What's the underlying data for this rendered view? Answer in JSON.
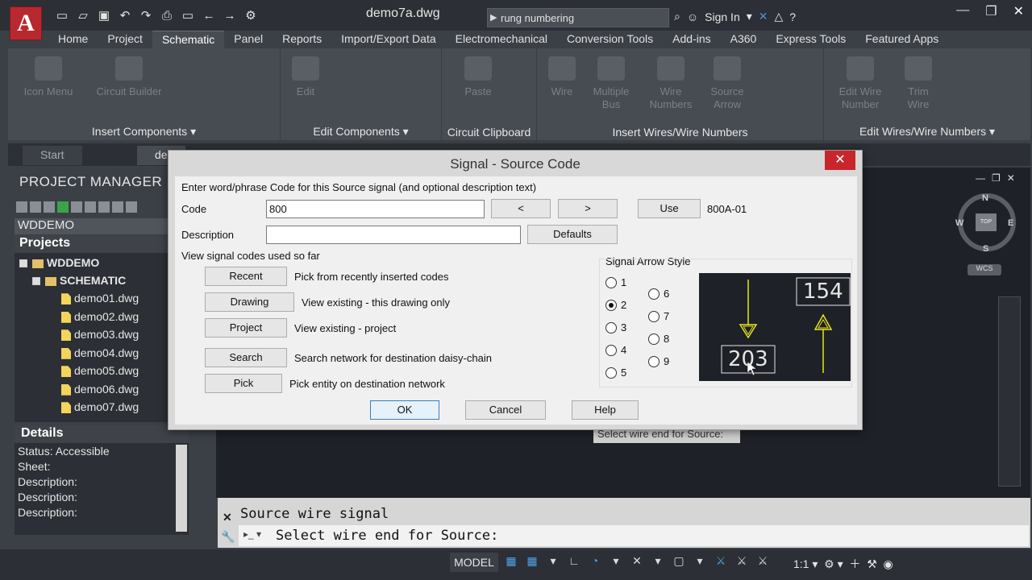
{
  "app": {
    "logo": "A",
    "doc_title": "demo7a.dwg",
    "search_value": "rung numbering",
    "sign_in": "Sign In"
  },
  "ribbon": {
    "tabs": [
      "Home",
      "Project",
      "Schematic",
      "Panel",
      "Reports",
      "Import/Export Data",
      "Electromechanical",
      "Conversion Tools",
      "Add-ins",
      "A360",
      "Express Tools",
      "Featured Apps"
    ],
    "active_tab": "Schematic",
    "groups": [
      {
        "title": "Insert Components",
        "buttons": [
          "Icon Menu",
          "Circuit Builder"
        ]
      },
      {
        "title": "Edit Components",
        "buttons": [
          "Edit"
        ]
      },
      {
        "title": "Circuit Clipboard",
        "buttons": [
          "Paste"
        ]
      },
      {
        "title": "Insert Wires/Wire Numbers",
        "buttons": [
          "Wire",
          "Multiple Bus",
          "Wire Numbers",
          "Source Arrow"
        ]
      },
      {
        "title": "Edit Wires/Wire Numbers",
        "buttons": [
          "Edit Wire Number",
          "Trim Wire"
        ]
      }
    ]
  },
  "doc_tabs": [
    "Start",
    "de"
  ],
  "project_manager": {
    "title": "PROJECT MANAGER",
    "project_selector": "WDDEMO",
    "tree_header": "Projects",
    "root": "WDDEMO",
    "folder": "SCHEMATIC",
    "files": [
      "demo01.dwg",
      "demo02.dwg",
      "demo03.dwg",
      "demo04.dwg",
      "demo05.dwg",
      "demo06.dwg",
      "demo07.dwg"
    ]
  },
  "details": {
    "title": "Details",
    "rows": [
      "Status: Accessible",
      "Sheet:",
      "Description:",
      "Description:",
      "Description:"
    ]
  },
  "drawing": {
    "viewcube": {
      "n": "N",
      "s": "S",
      "e": "E",
      "w": "W",
      "top": "TOP",
      "wcs": "WCS"
    },
    "tooltip": "Select wire end for Source:"
  },
  "command_line": {
    "history": "Source wire signal",
    "prompt": "Select wire end for Source:"
  },
  "status_bar": {
    "model": "MODEL",
    "scale": "1:1"
  },
  "dialog": {
    "title": "Signal - Source Code",
    "close": "✕",
    "instructions": "Enter word/phrase Code for this Source signal (and optional description text)",
    "code_label": "Code",
    "code_value": "800",
    "prev_label": "<",
    "next_label": ">",
    "use_label": "Use",
    "use_value": "800A-01",
    "description_label": "Description",
    "description_value": "",
    "defaults_label": "Defaults",
    "view_label": "View signal codes used so far",
    "view_buttons": [
      {
        "label": "Recent",
        "desc": "Pick from recently inserted codes"
      },
      {
        "label": "Drawing",
        "desc": "View existing - this drawing only"
      },
      {
        "label": "Project",
        "desc": "View existing - project"
      },
      {
        "label": "Search",
        "desc": "Search network for destination daisy-chain"
      },
      {
        "label": "Pick",
        "desc": "Pick entity on destination network"
      }
    ],
    "arrow_style_label": "Signal Arrow Style",
    "arrow_styles": [
      "1",
      "2",
      "3",
      "4",
      "5",
      "6",
      "7",
      "8",
      "9"
    ],
    "selected_style": "2",
    "preview": {
      "wire_a": "203",
      "wire_b": "154"
    },
    "ok": "OK",
    "cancel": "Cancel",
    "help": "Help"
  },
  "colors": {
    "dialog_close": "#c8262c",
    "preview_arrow": "#e6e61e",
    "logo": "#b8282f"
  }
}
